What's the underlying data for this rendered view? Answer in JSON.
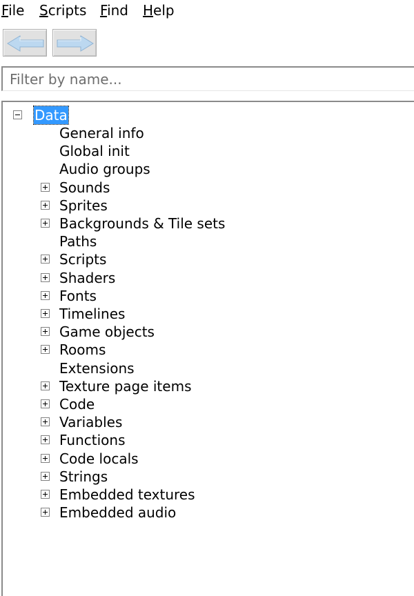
{
  "menu": {
    "items": [
      {
        "label": "File"
      },
      {
        "label": "Scripts"
      },
      {
        "label": "Find"
      },
      {
        "label": "Help"
      }
    ]
  },
  "toolbar": {
    "back_icon": "arrow-left-icon",
    "forward_icon": "arrow-right-icon"
  },
  "filter": {
    "placeholder": "Filter by name..."
  },
  "tree": {
    "root": {
      "label": "Data",
      "expanded": true,
      "selected": true
    },
    "items": [
      {
        "label": "General info",
        "expandable": false
      },
      {
        "label": "Global init",
        "expandable": false
      },
      {
        "label": "Audio groups",
        "expandable": false
      },
      {
        "label": "Sounds",
        "expandable": true
      },
      {
        "label": "Sprites",
        "expandable": true
      },
      {
        "label": "Backgrounds & Tile sets",
        "expandable": true
      },
      {
        "label": "Paths",
        "expandable": false
      },
      {
        "label": "Scripts",
        "expandable": true
      },
      {
        "label": "Shaders",
        "expandable": true
      },
      {
        "label": "Fonts",
        "expandable": true
      },
      {
        "label": "Timelines",
        "expandable": true
      },
      {
        "label": "Game objects",
        "expandable": true
      },
      {
        "label": "Rooms",
        "expandable": true
      },
      {
        "label": "Extensions",
        "expandable": false
      },
      {
        "label": "Texture page items",
        "expandable": true
      },
      {
        "label": "Code",
        "expandable": true
      },
      {
        "label": "Variables",
        "expandable": true
      },
      {
        "label": "Functions",
        "expandable": true
      },
      {
        "label": "Code locals",
        "expandable": true
      },
      {
        "label": "Strings",
        "expandable": true
      },
      {
        "label": "Embedded textures",
        "expandable": true
      },
      {
        "label": "Embedded audio",
        "expandable": true
      }
    ]
  },
  "colors": {
    "selection": "#3399ff",
    "arrow_fill": "#bcd8f0",
    "button_face": "#e1e1e1"
  }
}
